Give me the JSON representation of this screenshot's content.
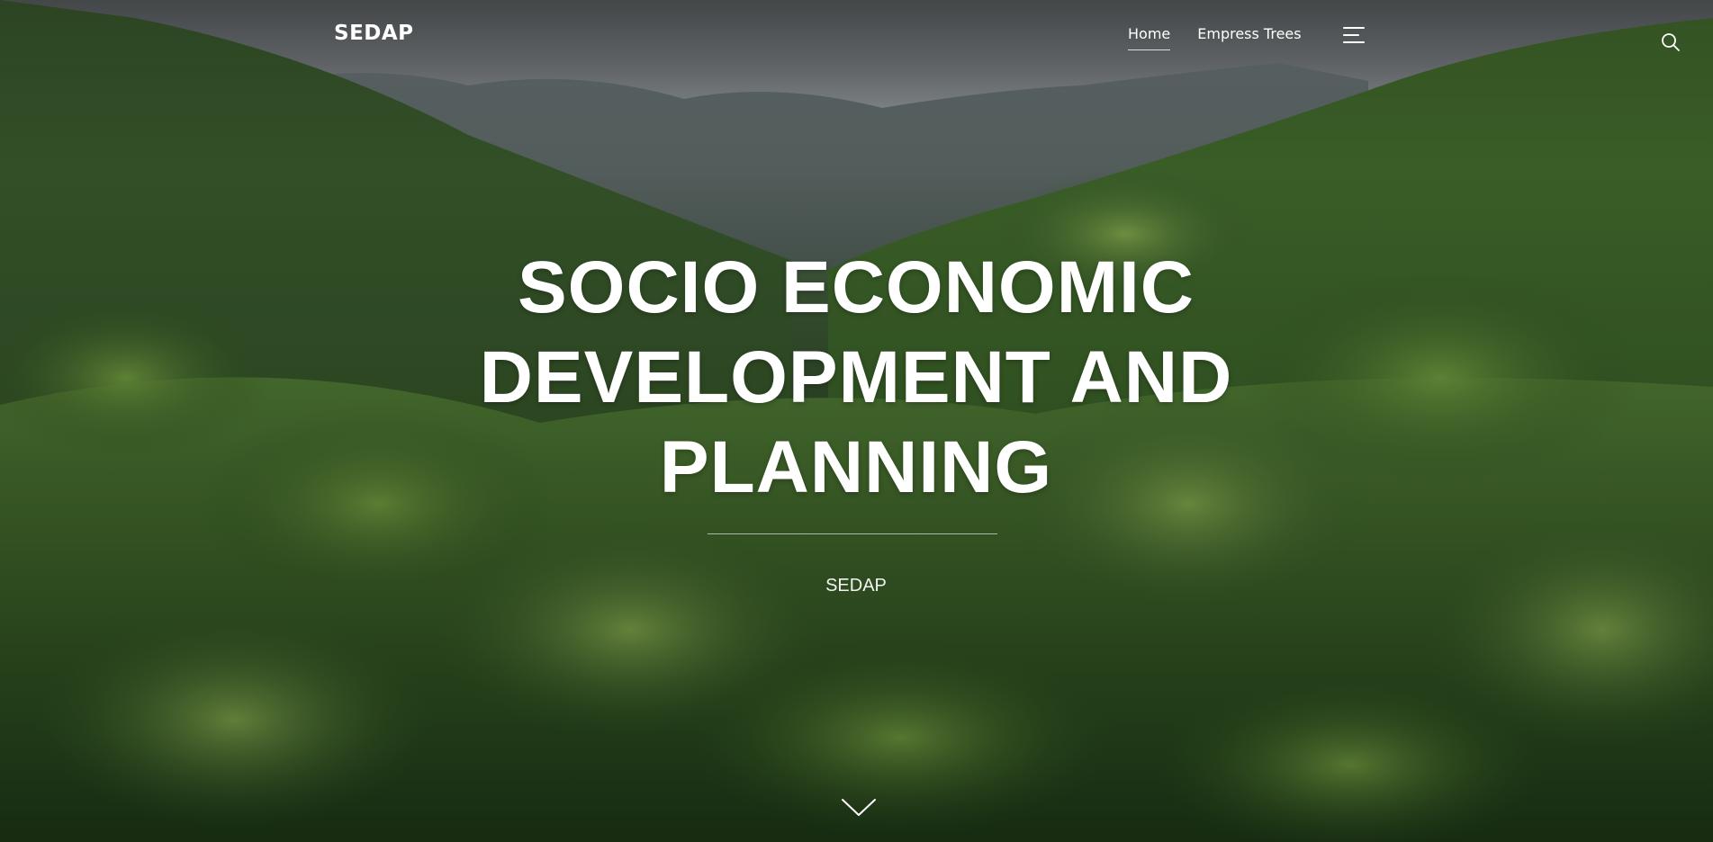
{
  "header": {
    "logo": "SEDAP",
    "nav": [
      {
        "label": "Home",
        "active": true
      },
      {
        "label": "Empress Trees",
        "active": false
      }
    ],
    "menu_icon": "hamburger-menu-icon",
    "search_icon": "search-icon"
  },
  "hero": {
    "title": "SOCIO ECONOMIC DEVELOPMENT AND PLANNING",
    "subtitle": "SEDAP",
    "scroll_icon": "chevron-down-icon"
  },
  "colors": {
    "text": "#ffffff",
    "forest": "#2f4a26",
    "sky": "#9aa0a3"
  }
}
